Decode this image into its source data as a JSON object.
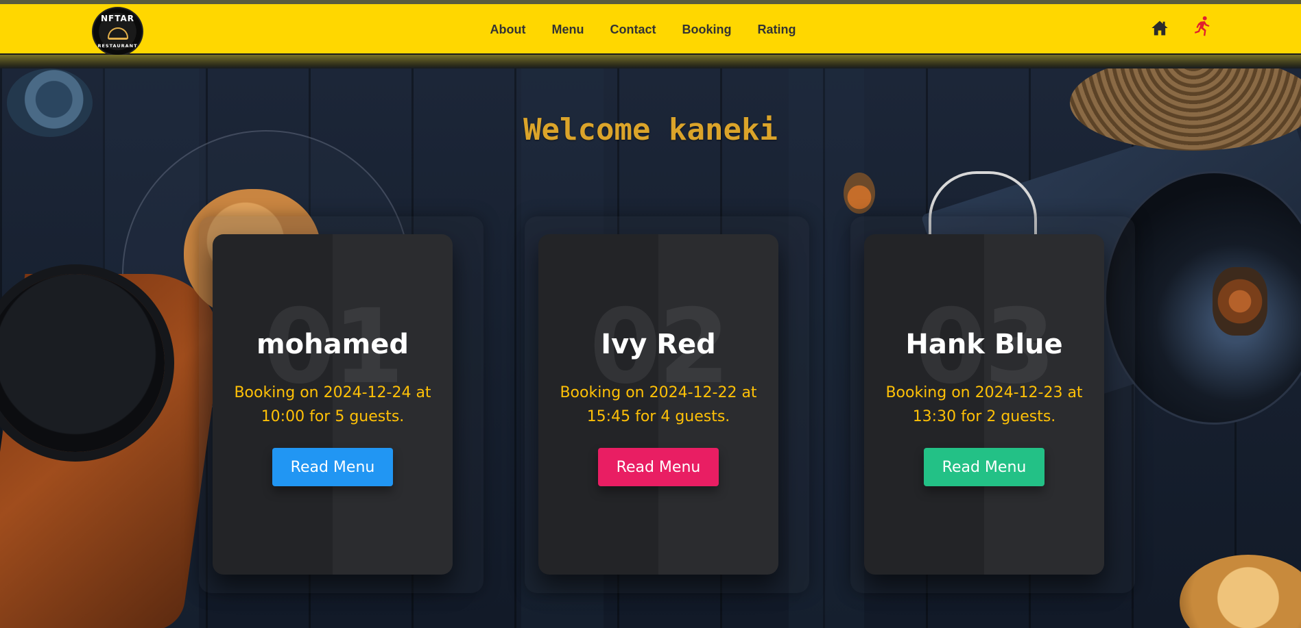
{
  "header": {
    "logo": {
      "top_text": "NFTAR",
      "bottom_text": "RESTAURANT"
    },
    "nav": [
      {
        "label": "About"
      },
      {
        "label": "Menu"
      },
      {
        "label": "Contact"
      },
      {
        "label": "Booking"
      },
      {
        "label": "Rating"
      }
    ],
    "icons": {
      "home": "home-icon",
      "logout": "running-person-icon"
    },
    "colors": {
      "background": "#ffd700",
      "nav_text": "#333333",
      "logout_icon": "#e0202e"
    }
  },
  "main": {
    "welcome": "Welcome kaneki",
    "welcome_color": "#dba42a",
    "cards": [
      {
        "number": "01",
        "name": "mohamed",
        "text": "Booking on 2024-12-24 at 10:00 for 5 guests.",
        "button_label": "Read Menu",
        "button_color": "#2196f3"
      },
      {
        "number": "02",
        "name": "Ivy Red",
        "text": "Booking on 2024-12-22 at 15:45 for 4 guests.",
        "button_label": "Read Menu",
        "button_color": "#e91e63"
      },
      {
        "number": "03",
        "name": "Hank Blue",
        "text": "Booking on 2024-12-23 at 13:30 for 2 guests.",
        "button_label": "Read Menu",
        "button_color": "#23c186"
      }
    ],
    "card_text_color": "#ffc107"
  }
}
